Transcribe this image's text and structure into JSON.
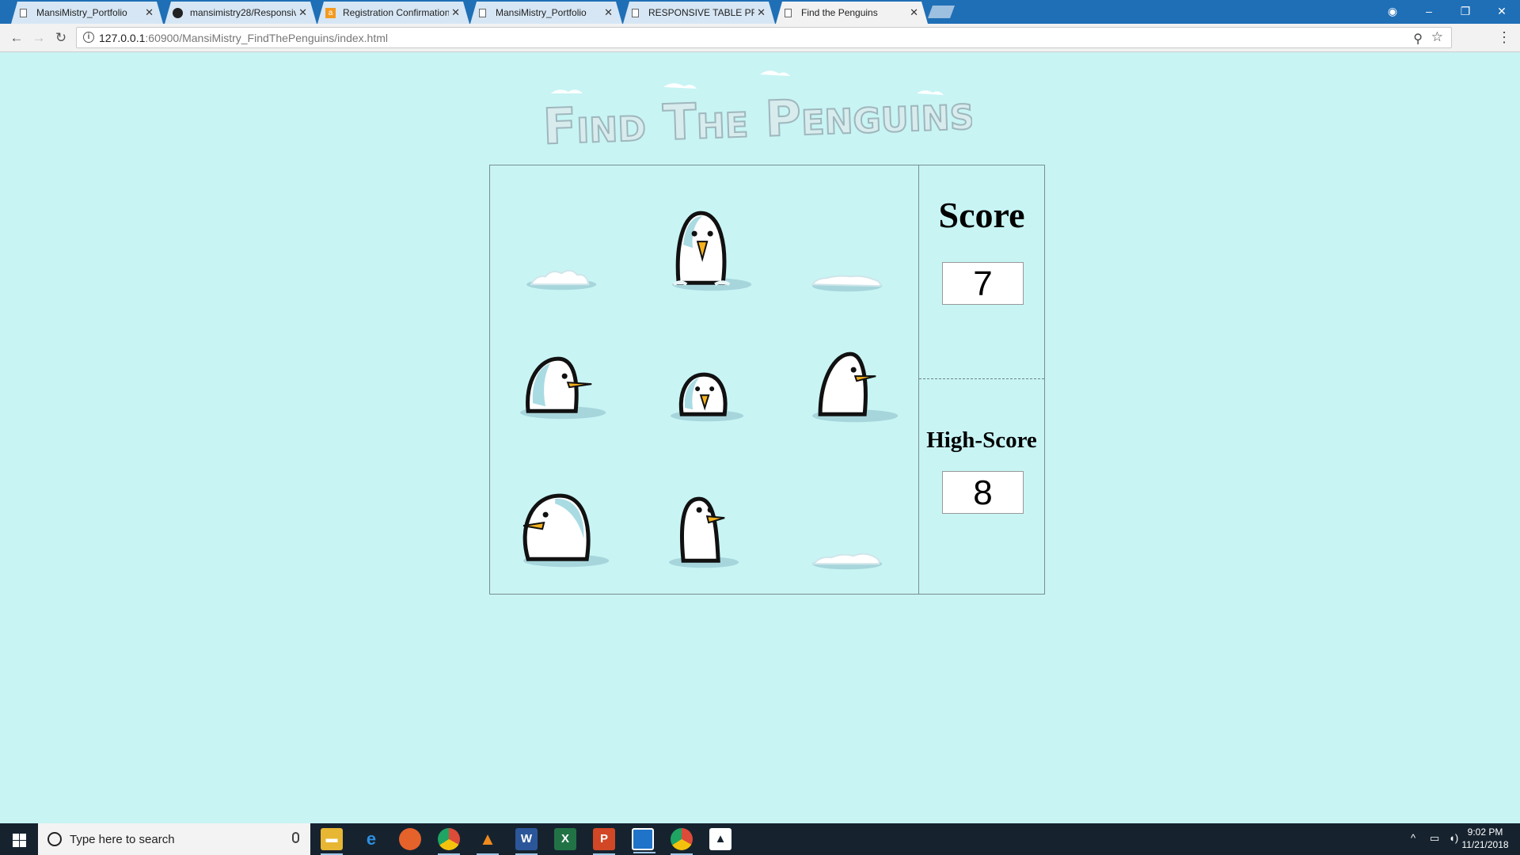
{
  "browser": {
    "tabs": [
      {
        "title": "MansiMistry_Portfolio",
        "icon": "document-icon",
        "active": false
      },
      {
        "title": "mansimistry28/Responsiv",
        "icon": "github-icon",
        "active": false
      },
      {
        "title": "Registration Confirmation",
        "icon": "amazon-icon",
        "active": false
      },
      {
        "title": "MansiMistry_Portfolio",
        "icon": "document-icon",
        "active": false
      },
      {
        "title": "RESPONSIVE TABLE PRO",
        "icon": "document-icon",
        "active": false
      },
      {
        "title": "Find the Penguins",
        "icon": "document-icon",
        "active": true
      }
    ],
    "close_glyph": "✕",
    "url_host": "127.0.0.1",
    "url_rest": ":60900/MansiMistry_FindThePenguins/index.html"
  },
  "game": {
    "logo_text": "Find The Penguins",
    "board": [
      {
        "content": "snow"
      },
      {
        "content": "penguin-front"
      },
      {
        "content": "snow"
      },
      {
        "content": "penguin-side-right"
      },
      {
        "content": "penguin-small"
      },
      {
        "content": "penguin-side-right"
      },
      {
        "content": "penguin-side-left"
      },
      {
        "content": "penguin-tall"
      },
      {
        "content": "snow"
      }
    ],
    "score_label": "Score",
    "score_value": "7",
    "high_score_label": "High-Score",
    "high_score_value": "8"
  },
  "taskbar": {
    "search_placeholder": "Type here to search",
    "apps": [
      "file-explorer-icon",
      "edge-icon",
      "firefox-icon",
      "chrome-icon",
      "vlc-icon",
      "word-icon",
      "excel-icon",
      "powerpoint-icon",
      "app-icon",
      "chrome-icon",
      "photos-icon"
    ],
    "clock_time": "9:02 PM",
    "clock_date": "11/21/2018"
  },
  "colors": {
    "page_background": "#c8f4f4",
    "tabstrip": "#1f6fb6",
    "taskbar": "#16232f"
  }
}
